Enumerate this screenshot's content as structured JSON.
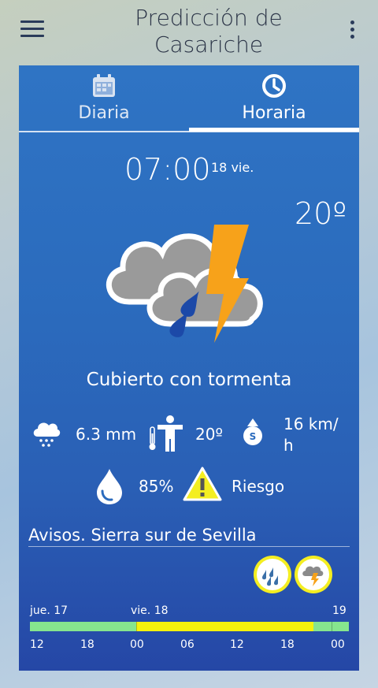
{
  "appbar": {
    "title": "Predicción de Casariche",
    "menu_icon": "hamburger-menu-icon",
    "more_icon": "more-vert-icon"
  },
  "tabs": [
    {
      "label": "Diaria",
      "icon": "calendar-icon",
      "active": false
    },
    {
      "label": "Horaria",
      "icon": "clock-icon",
      "active": true
    }
  ],
  "forecast": {
    "time": "07:00",
    "date": "18 vie.",
    "temperature": "20º",
    "condition_icon": "cloud-rain-thunderstorm-icon",
    "description": "Cubierto con tormenta",
    "precipitation": "6.3 mm",
    "feels_like": "20º",
    "wind": "16 km/ h",
    "wind_direction": "S",
    "humidity": "85%",
    "risk": "Riesgo"
  },
  "warnings": {
    "title": "Avisos. Sierra sur de Sevilla",
    "badges": [
      {
        "icon": "rain-warning-icon",
        "color": "#f4ee21"
      },
      {
        "icon": "storm-warning-icon",
        "color": "#f4ee21"
      }
    ]
  },
  "timeline": {
    "day_labels": [
      "jue. 17",
      "vie. 18",
      "19"
    ],
    "segments": [
      {
        "level": "green",
        "color": "#86e58e",
        "from_hour": 12,
        "to_hour": 24
      },
      {
        "level": "yellow",
        "color": "#f5f20d",
        "from_hour": 24,
        "to_hour": 44
      },
      {
        "level": "green",
        "color": "#86e58e",
        "from_hour": 44,
        "to_hour": 48
      }
    ],
    "hour_ticks": [
      "12",
      "18",
      "00",
      "06",
      "12",
      "18",
      "00"
    ]
  },
  "colors": {
    "card_blue": "#2b6bbd",
    "bolt": "#f7a21a",
    "raindrop": "#1c49a8",
    "warning_yellow": "#f4ee21"
  }
}
